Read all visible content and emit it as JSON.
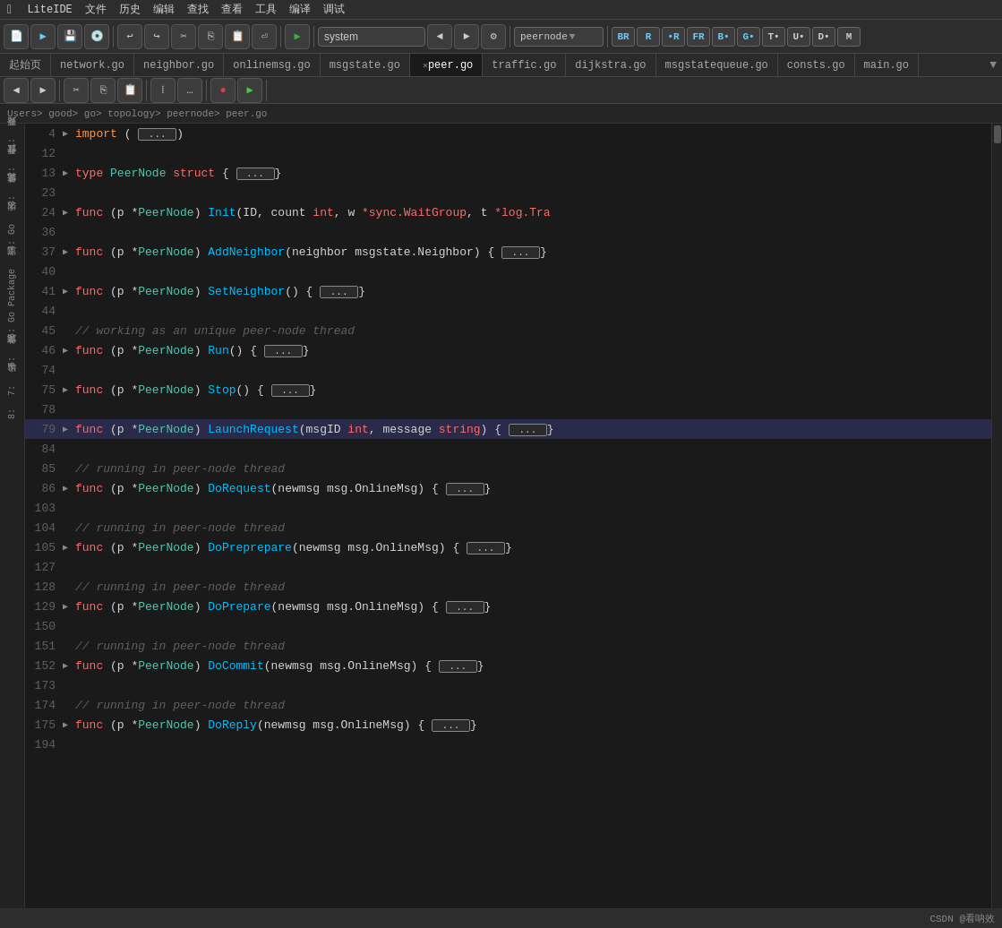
{
  "menubar": {
    "apple": "&#xF8FF;",
    "items": [
      "LiteIDE",
      "文件",
      "历史",
      "编辑",
      "查找",
      "查看",
      "工具",
      "编译",
      "调试"
    ]
  },
  "toolbar": {
    "search_placeholder": "system",
    "peernode_label": "peernode"
  },
  "tabs": [
    {
      "label": "起始页",
      "active": false,
      "closable": false
    },
    {
      "label": "network.go",
      "active": false,
      "closable": false
    },
    {
      "label": "neighbor.go",
      "active": false,
      "closable": false
    },
    {
      "label": "onlinemsg.go",
      "active": false,
      "closable": false
    },
    {
      "label": "msgstate.go",
      "active": false,
      "closable": false
    },
    {
      "label": "peer.go",
      "active": true,
      "closable": true
    },
    {
      "label": "traffic.go",
      "active": false,
      "closable": false
    },
    {
      "label": "dijkstra.go",
      "active": false,
      "closable": false
    },
    {
      "label": "msgstatequeue.go",
      "active": false,
      "closable": false
    },
    {
      "label": "consts.go",
      "active": false,
      "closable": false
    },
    {
      "label": "main.go",
      "active": false,
      "closable": false
    }
  ],
  "breadcrumb": "Users> good> go> topology> peernode> peer.go",
  "sidebar_items": [
    {
      "label": "1: 开始页"
    },
    {
      "label": "2: 打开文件"
    },
    {
      "label": "3: 文件系统"
    },
    {
      "label": "4: Go 大纲"
    },
    {
      "label": "5: Go Package 浏览"
    },
    {
      "label": "6: 文件浏览"
    },
    {
      "label": "7: 输出"
    },
    {
      "label": "8:"
    }
  ],
  "code_lines": [
    {
      "num": "4",
      "fold": true,
      "content": "import_block"
    },
    {
      "num": "12",
      "fold": false,
      "content": "blank"
    },
    {
      "num": "13",
      "fold": true,
      "content": "type_peernode"
    },
    {
      "num": "23",
      "fold": false,
      "content": "blank"
    },
    {
      "num": "24",
      "fold": true,
      "content": "func_init"
    },
    {
      "num": "36",
      "fold": false,
      "content": "blank"
    },
    {
      "num": "37",
      "fold": true,
      "content": "func_addneighbor"
    },
    {
      "num": "40",
      "fold": false,
      "content": "blank"
    },
    {
      "num": "41",
      "fold": true,
      "content": "func_setneighbor"
    },
    {
      "num": "44",
      "fold": false,
      "content": "blank"
    },
    {
      "num": "45",
      "fold": false,
      "content": "comment_working"
    },
    {
      "num": "46",
      "fold": true,
      "content": "func_run"
    },
    {
      "num": "74",
      "fold": false,
      "content": "blank"
    },
    {
      "num": "75",
      "fold": true,
      "content": "func_stop"
    },
    {
      "num": "78",
      "fold": false,
      "content": "blank"
    },
    {
      "num": "79",
      "fold": true,
      "content": "func_launchrequest",
      "highlighted": true
    },
    {
      "num": "84",
      "fold": false,
      "content": "blank"
    },
    {
      "num": "85",
      "fold": false,
      "content": "comment_running1"
    },
    {
      "num": "86",
      "fold": true,
      "content": "func_dorequest"
    },
    {
      "num": "103",
      "fold": false,
      "content": "blank"
    },
    {
      "num": "104",
      "fold": false,
      "content": "comment_running2"
    },
    {
      "num": "105",
      "fold": true,
      "content": "func_dopreprepare"
    },
    {
      "num": "127",
      "fold": false,
      "content": "blank"
    },
    {
      "num": "128",
      "fold": false,
      "content": "comment_running3"
    },
    {
      "num": "129",
      "fold": true,
      "content": "func_doprepare"
    },
    {
      "num": "150",
      "fold": false,
      "content": "blank"
    },
    {
      "num": "151",
      "fold": false,
      "content": "comment_running4"
    },
    {
      "num": "152",
      "fold": true,
      "content": "func_docommit"
    },
    {
      "num": "173",
      "fold": false,
      "content": "blank"
    },
    {
      "num": "174",
      "fold": false,
      "content": "comment_running5"
    },
    {
      "num": "175",
      "fold": true,
      "content": "func_doreply"
    },
    {
      "num": "194",
      "fold": false,
      "content": "blank"
    }
  ],
  "statusbar": {
    "text": "CSDN @看呐效"
  }
}
